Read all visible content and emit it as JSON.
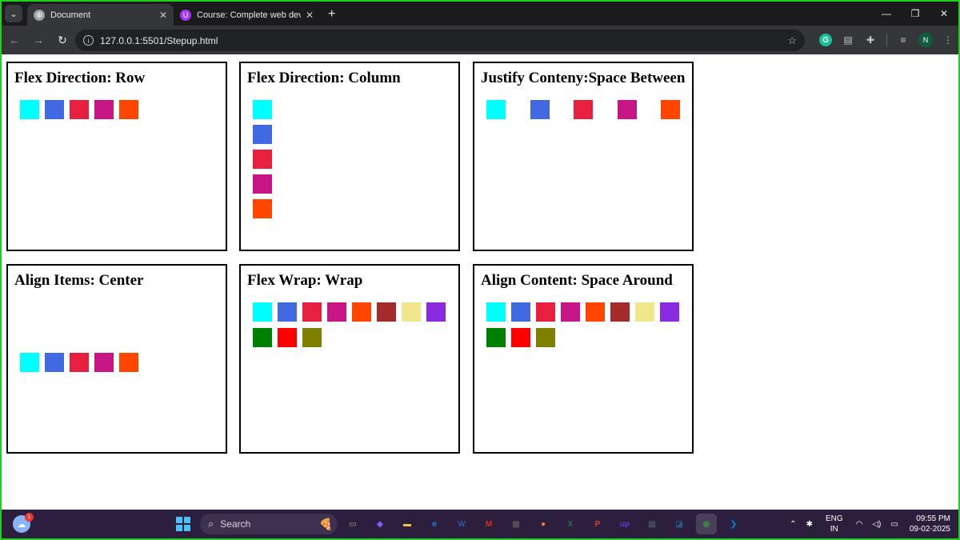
{
  "browser": {
    "tabs": [
      {
        "title": "Document",
        "icon": "globe-icon",
        "active": true
      },
      {
        "title": "Course: Complete web develop",
        "icon": "udemy-icon",
        "active": false
      }
    ],
    "address": "127.0.0.1:5501/Stepup.html",
    "profile_initial": "N",
    "grammarly_letter": "G"
  },
  "page": {
    "boxes": [
      {
        "title": "Flex Direction: Row",
        "colors": [
          "#00ffff",
          "#4169e1",
          "#e8203f",
          "#c71585",
          "#ff4500"
        ]
      },
      {
        "title": "Flex Direction: Column",
        "colors": [
          "#00ffff",
          "#4169e1",
          "#e8203f",
          "#c71585",
          "#ff4500"
        ]
      },
      {
        "title": "Justify Conteny:Space Between",
        "colors": [
          "#00ffff",
          "#4169e1",
          "#e8203f",
          "#c71585",
          "#ff4500"
        ]
      },
      {
        "title": "Align Items: Center",
        "colors": [
          "#00ffff",
          "#4169e1",
          "#e8203f",
          "#c71585",
          "#ff4500"
        ]
      },
      {
        "title": "Flex Wrap: Wrap",
        "colors": [
          "#00ffff",
          "#4169e1",
          "#e8203f",
          "#c71585",
          "#ff4500",
          "#a52a2a",
          "#f0e68c",
          "#8a2be2",
          "#008000",
          "#ff0000",
          "#808000"
        ]
      },
      {
        "title": "Align Content: Space Around",
        "colors": [
          "#00ffff",
          "#4169e1",
          "#e8203f",
          "#c71585",
          "#ff4500",
          "#a52a2a",
          "#f0e68c",
          "#8a2be2",
          "#008000",
          "#ff0000",
          "#808000"
        ]
      }
    ]
  },
  "taskbar": {
    "search_placeholder": "Search",
    "weather_badge": "1",
    "language": {
      "line1": "ENG",
      "line2": "IN"
    },
    "time": "09:55 PM",
    "date": "09-02-2025",
    "apps": [
      {
        "name": "task-view",
        "label": "▭",
        "color": "#777777"
      },
      {
        "name": "copilot",
        "label": "◆",
        "color": "#7b5cff"
      },
      {
        "name": "file-explorer",
        "label": "▬",
        "color": "#f5c542"
      },
      {
        "name": "edge",
        "label": "e",
        "color": "#1e88e5"
      },
      {
        "name": "word",
        "label": "W",
        "color": "#2b579a"
      },
      {
        "name": "gmail",
        "label": "M",
        "color": "#d93025"
      },
      {
        "name": "store",
        "label": "▦",
        "color": "#555555"
      },
      {
        "name": "firefox",
        "label": "●",
        "color": "#ff7139"
      },
      {
        "name": "excel",
        "label": "X",
        "color": "#217346"
      },
      {
        "name": "powerpoint",
        "label": "P",
        "color": "#d24726"
      },
      {
        "name": "upwork",
        "label": "up",
        "color": "#6a35c9"
      },
      {
        "name": "calculator",
        "label": "▤",
        "color": "#4a5568"
      },
      {
        "name": "sticky-app",
        "label": "◪",
        "color": "#2b5a8a"
      },
      {
        "name": "chrome",
        "label": "◉",
        "color": "#3c8d40"
      },
      {
        "name": "vscode",
        "label": "❯",
        "color": "#007acc"
      }
    ]
  }
}
